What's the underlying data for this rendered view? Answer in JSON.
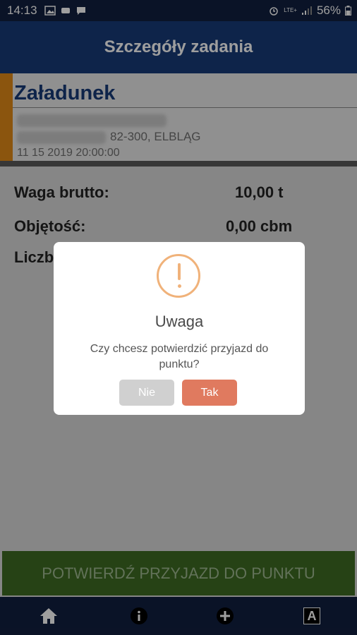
{
  "status_bar": {
    "time": "14:13",
    "lte": "LTE+",
    "battery": "56%"
  },
  "app_bar": {
    "title": "Szczegóły zadania"
  },
  "task": {
    "title": "Załadunek",
    "address": "82-300, ELBLĄG",
    "datetime": "11 15 2019 20:00:00"
  },
  "details": [
    {
      "label": "Waga brutto:",
      "value": "10,00 t"
    },
    {
      "label": "Objętość:",
      "value": "0,00 cbm"
    },
    {
      "label": "Liczb",
      "value": ""
    }
  ],
  "dialog": {
    "title": "Uwaga",
    "message": "Czy chcesz potwierdzić przyjazd do punktu?",
    "no_label": "Nie",
    "yes_label": "Tak"
  },
  "confirm_button": {
    "label": "POTWIERDŹ PRZYJAZD DO PUNKTU"
  },
  "bottom_nav": {
    "icons": [
      "home-icon",
      "info-icon",
      "add-icon",
      "font-icon"
    ],
    "font_glyph": "A"
  },
  "colors": {
    "header": "#173a78",
    "accent_orange": "#e08a17",
    "confirm_green": "#3e6b22",
    "yes_button": "#e07a5f",
    "warning_icon": "#f0b27a"
  }
}
